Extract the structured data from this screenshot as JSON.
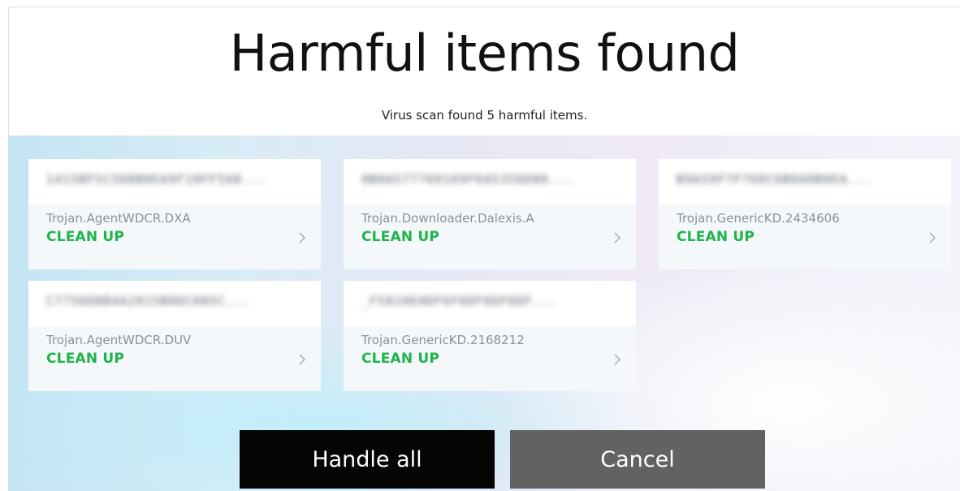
{
  "header": {
    "title": "Harmful items found",
    "subtitle": "Virus scan found 5 harmful items."
  },
  "items": [
    {
      "blurred_name": "1415BF5C5D8B0EA9F10FF5A8...",
      "threat": "Trojan.AgentWDCR.DXA",
      "action": "CLEAN UP",
      "icon": "chevron-right-icon"
    },
    {
      "blurred_name": "0B0A577760169F6A5356D80...",
      "threat": "Trojan.Downloader.Dalexis.A",
      "action": "CLEAN UP",
      "icon": "chevron-right-icon"
    },
    {
      "blurred_name": "B9A59F7F760C6B0A0B0EA...",
      "threat": "Trojan.GenericKD.2434606",
      "action": "CLEAN UP",
      "icon": "chevron-right-icon"
    },
    {
      "blurred_name": "C7756D8B4A2015B0DC085C...",
      "threat": "Trojan.AgentWDCR.DUV",
      "action": "CLEAN UP",
      "icon": "chevron-right-icon"
    },
    {
      "blurred_name": "_F5810E0DF6F6DF6DF6DF...",
      "threat": "Trojan.GenericKD.2168212",
      "action": "CLEAN UP",
      "icon": "chevron-right-icon"
    }
  ],
  "buttons": {
    "handle_all": "Handle all",
    "cancel": "Cancel"
  },
  "colors": {
    "action_green": "#1fb449",
    "primary_button": "#050505",
    "secondary_button": "#626262"
  }
}
